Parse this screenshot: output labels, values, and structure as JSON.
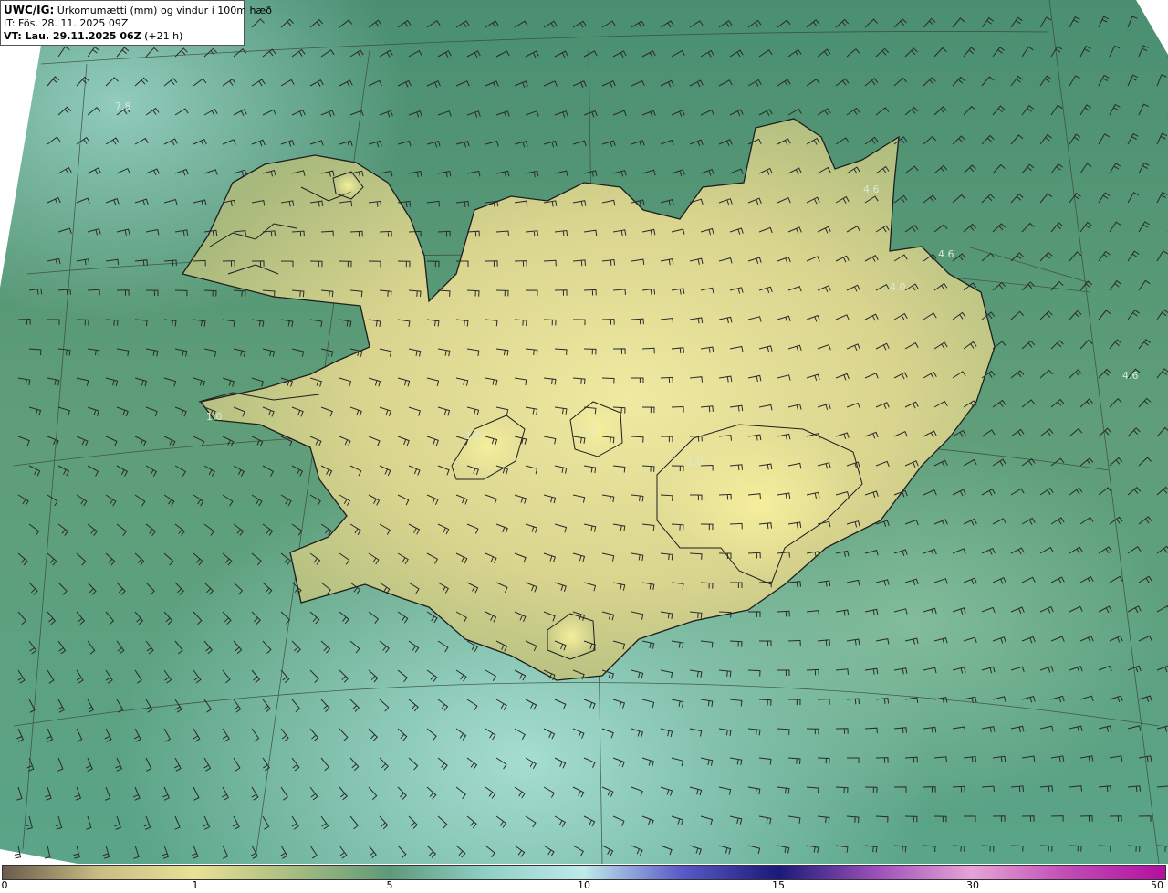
{
  "header": {
    "product": "UWC/IG:",
    "title": "Úrkomumætti (mm) og vindur í 100m hæð",
    "issue_time": "IT: Fös. 28. 11. 2025 09Z",
    "valid_label": "VT: Lau. 29.11.2025 06Z",
    "valid_offset": "(+21 h)"
  },
  "map_labels": [
    {
      "text": "7.8"
    },
    {
      "text": "4.6"
    },
    {
      "text": "4.6"
    },
    {
      "text": "4.0"
    },
    {
      "text": "4.6"
    },
    {
      "text": "1.0"
    },
    {
      "text": "1.2"
    },
    {
      "text": "1.0"
    },
    {
      "text": "1.0"
    }
  ],
  "colorbar": {
    "ticks": [
      "0",
      "1",
      "5",
      "10",
      "15",
      "30",
      "50"
    ],
    "colors": [
      "#6b5b4b",
      "#e9e195",
      "#5e9a79",
      "#bfeaea",
      "#1a1a78",
      "#e7a3d8",
      "#b30fa0"
    ]
  },
  "colors": {
    "sea": "#4f9274",
    "sea_light": "#8fcabc",
    "land": "#c6c583",
    "land_bright": "#ede9a0",
    "coast": "#222222",
    "barb": "#2a2a2a"
  }
}
